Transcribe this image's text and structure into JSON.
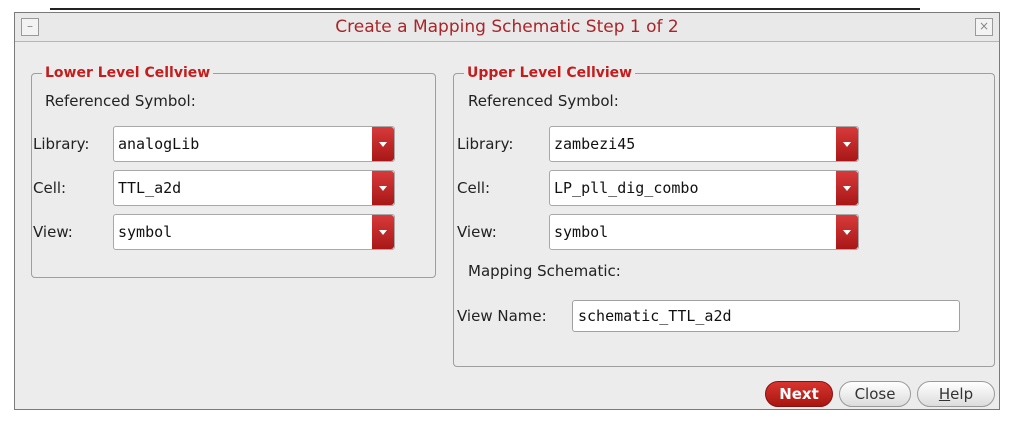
{
  "window": {
    "title": "Create a Mapping Schematic Step 1 of 2",
    "close_symbol": "×"
  },
  "lower": {
    "legend": "Lower Level Cellview",
    "ref_label": "Referenced Symbol:",
    "library_label": "Library:",
    "library_value": "analogLib",
    "cell_label": "Cell:",
    "cell_value": "TTL_a2d",
    "view_label": "View:",
    "view_value": "symbol"
  },
  "upper": {
    "legend": "Upper Level Cellview",
    "ref_label": "Referenced Symbol:",
    "library_label": "Library:",
    "library_value": "zambezi45",
    "cell_label": "Cell:",
    "cell_value": "LP_pll_dig_combo",
    "view_label": "View:",
    "view_value": "symbol",
    "mapping_label": "Mapping Schematic:",
    "viewname_label": "View Name:",
    "viewname_value": "schematic_TTL_a2d"
  },
  "buttons": {
    "next": "Next",
    "close": "Close",
    "help_first": "H",
    "help_rest": "elp"
  },
  "colors": {
    "title": "#a8262a",
    "legend": "#c41d1d",
    "accent": "#c0201a"
  },
  "icons": {
    "minimize": "minimize-icon",
    "close": "close-icon",
    "dropdown": "dropdown-arrow-icon"
  }
}
